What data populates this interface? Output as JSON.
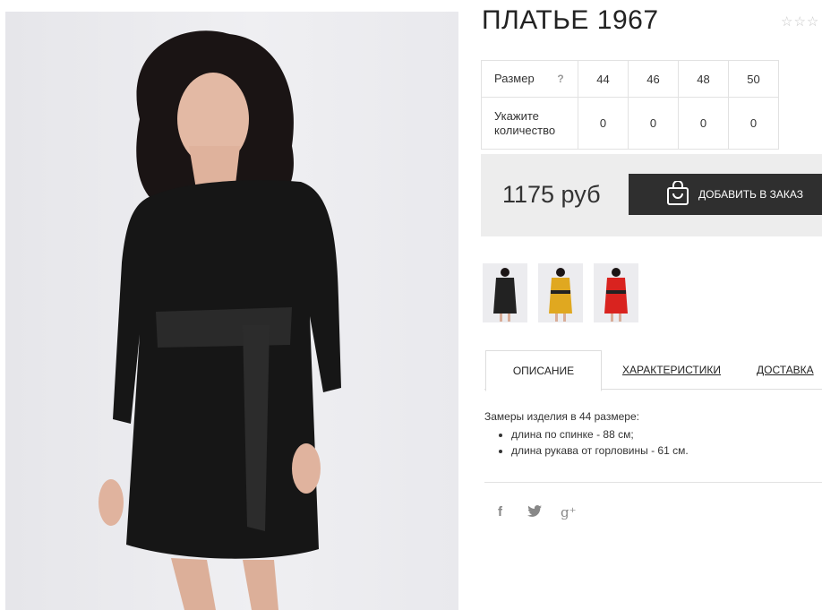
{
  "product": {
    "title": "ПЛАТЬЕ 1967",
    "rating_stars": "☆☆☆"
  },
  "size_table": {
    "size_label": "Размер",
    "help_label": "?",
    "sizes": [
      "44",
      "46",
      "48",
      "50"
    ],
    "quantity_label": "Укажите количество",
    "quantities": [
      "0",
      "0",
      "0",
      "0"
    ]
  },
  "purchase": {
    "price": "1175 руб",
    "add_button": "ДОБАВИТЬ В ЗАКАЗ"
  },
  "thumbnails": [
    {
      "color": "#222222"
    },
    {
      "color": "#e0a820"
    },
    {
      "color": "#d9231f"
    }
  ],
  "tabs": [
    {
      "label": "ОПИСАНИЕ"
    },
    {
      "label": "ХАРАКТЕРИСТИКИ"
    },
    {
      "label": "ДОСТАВКА"
    }
  ],
  "description": {
    "intro": "Замеры изделия в 44 размере:",
    "items": [
      "длина по спинке - 88 см;",
      "длина рукава от горловины - 61 см."
    ]
  },
  "social": {
    "facebook": "f",
    "twitter": "🐦",
    "googleplus": "g⁺"
  }
}
